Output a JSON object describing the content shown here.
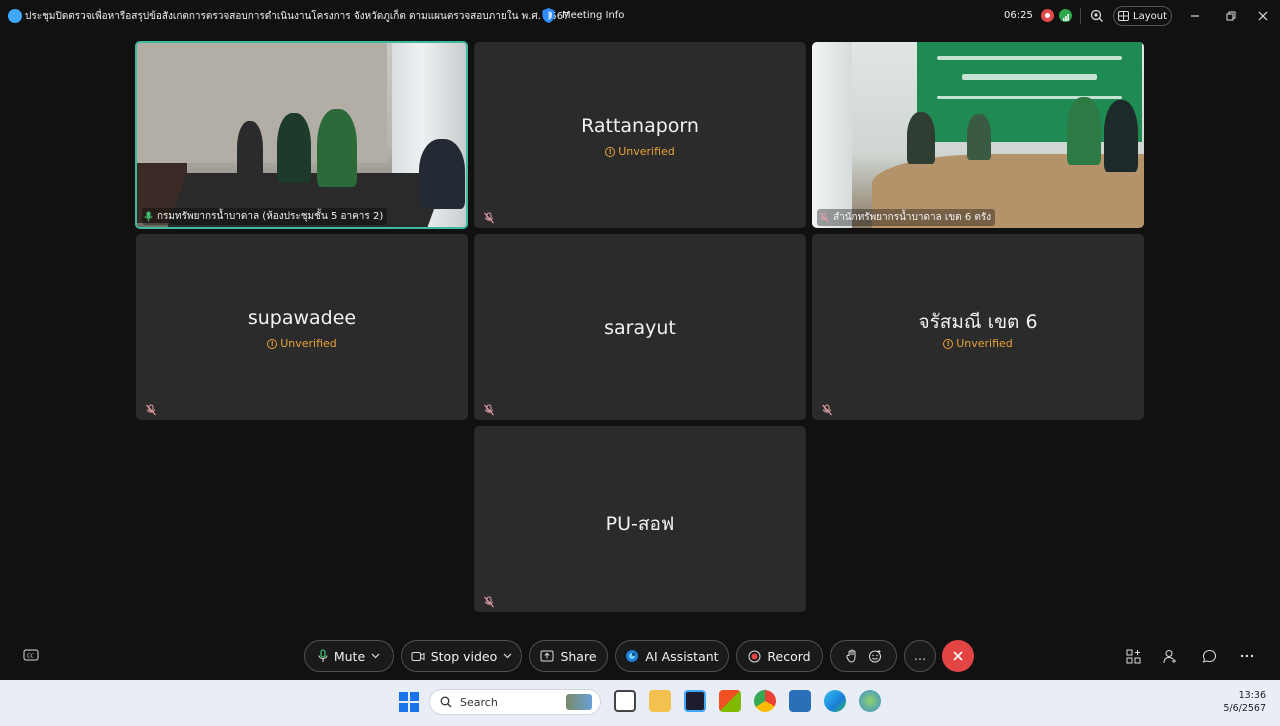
{
  "window": {
    "title": "ประชุมปิดตรวจเพื่อหารือสรุปข้อสังเกตการตรวจสอบการดำเนินงานโครงการ จังหวัดภูเก็ต ตามแผนตรวจสอบภายใน พ.ศ. 2567",
    "meeting_info_label": "Meeting Info",
    "elapsed_time": "06:25",
    "layout_label": "Layout"
  },
  "tiles": [
    {
      "type": "video",
      "label": "กรมทรัพยากรน้ำบาดาล (ห้องประชุมชั้น 5 อาคาร 2)",
      "active": true,
      "mic": "on"
    },
    {
      "type": "name",
      "name": "Rattanaporn",
      "badge": "Unverified",
      "mic": "off"
    },
    {
      "type": "video",
      "label": "สำนักทรัพยากรน้ำบาดาล เขต 6 ตรัง",
      "active": false,
      "mic": "off"
    },
    {
      "type": "name",
      "name": "supawadee",
      "badge": "Unverified",
      "mic": "off"
    },
    {
      "type": "name",
      "name": "sarayut",
      "badge": "",
      "mic": "off"
    },
    {
      "type": "name",
      "name": "จรัสมณี เขต 6",
      "badge": "Unverified",
      "mic": "off"
    },
    {
      "type": "name",
      "name": "PU-สอฟ",
      "badge": "",
      "mic": "off"
    }
  ],
  "toolbar": {
    "mute_label": "Mute",
    "stop_video_label": "Stop video",
    "share_label": "Share",
    "ai_assistant_label": "AI Assistant",
    "record_label": "Record",
    "more_label": "…"
  },
  "taskbar": {
    "search_placeholder": "Search",
    "time": "13:36",
    "date": "5/6/2567"
  },
  "colors": {
    "active_border": "#3fb9a0",
    "unverified": "#e7a23a",
    "end_call": "#e34444",
    "mic_off": "#e3a0a6"
  }
}
